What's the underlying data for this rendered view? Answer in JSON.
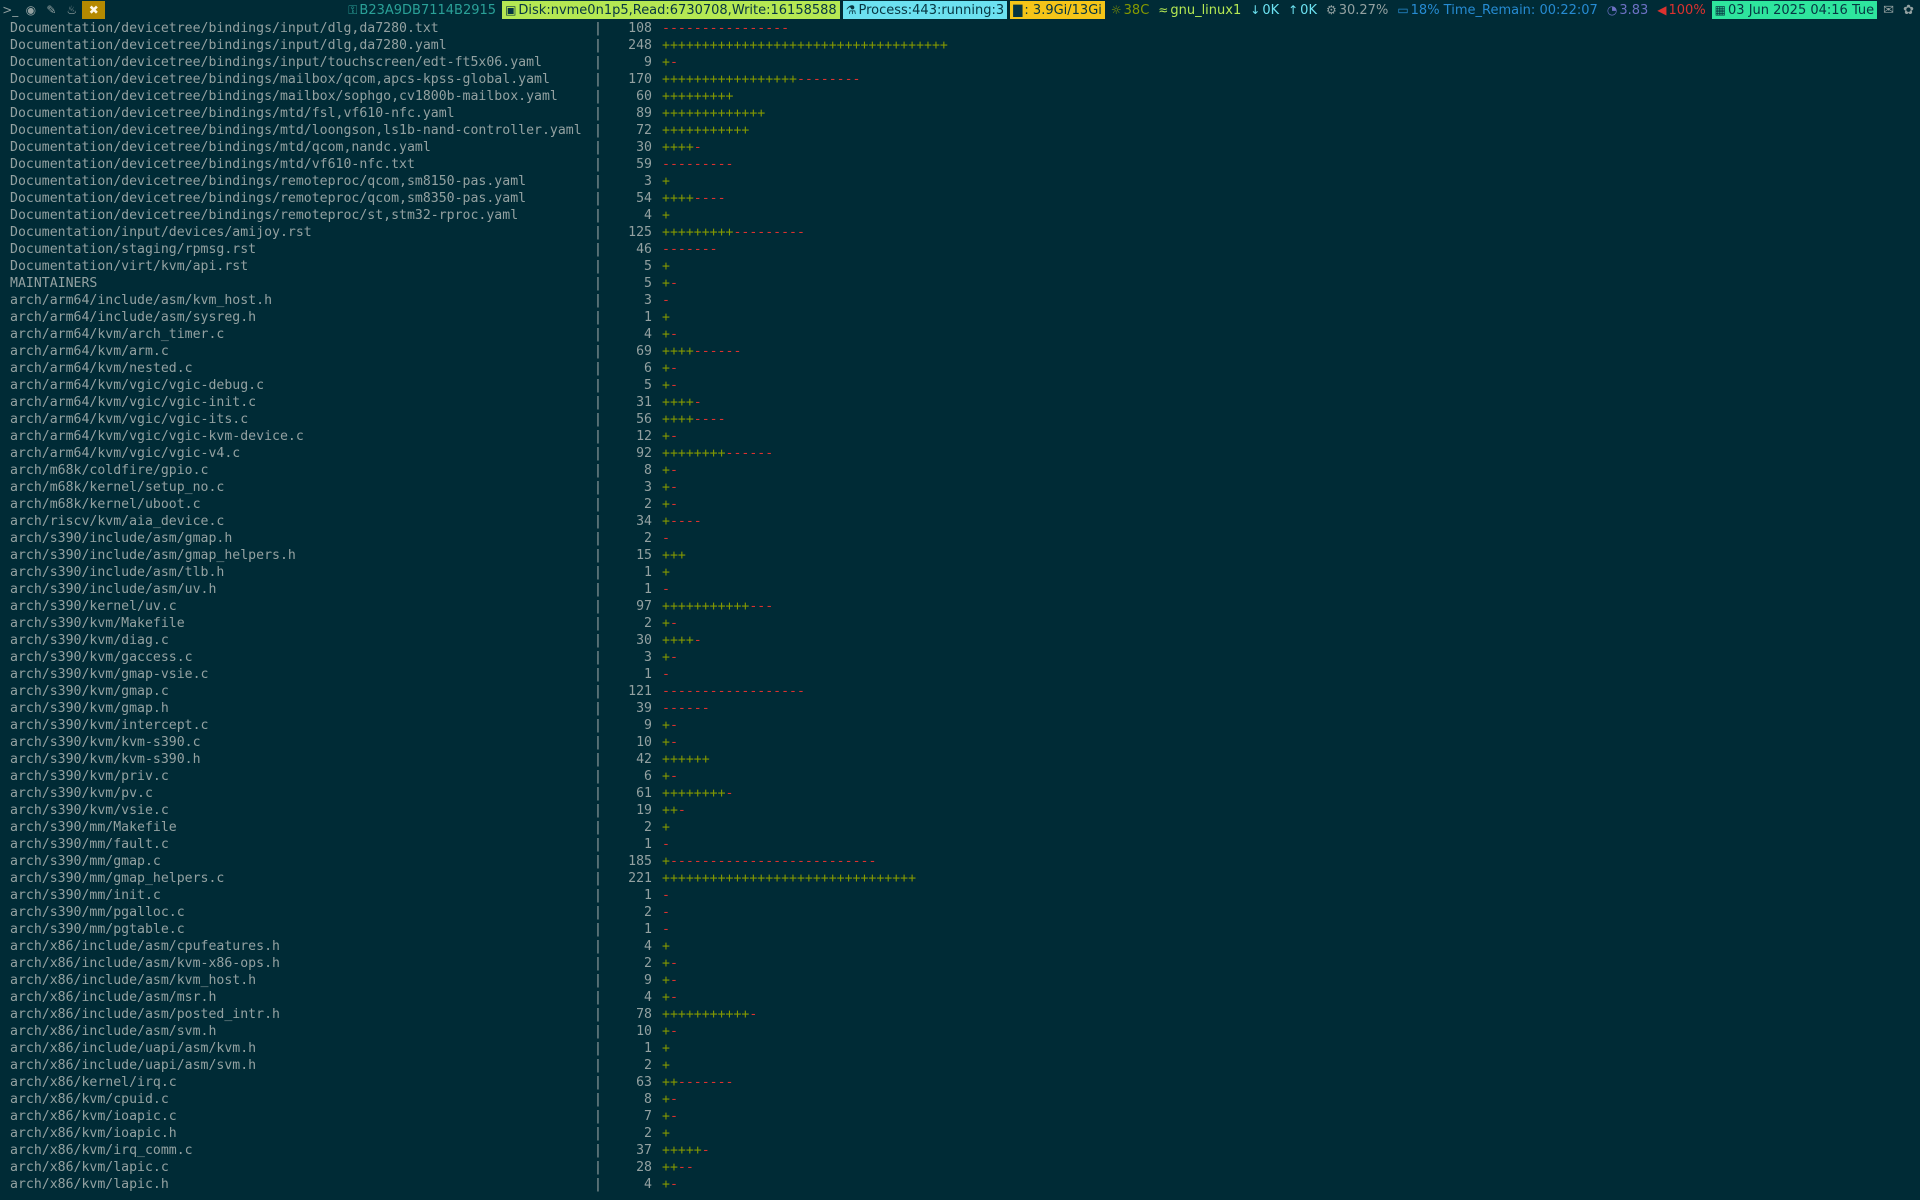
{
  "statusbar": {
    "workspaces": [
      {
        "label": ">_",
        "icon": "terminal-icon"
      },
      {
        "label": "◉",
        "icon": "firefox-icon"
      },
      {
        "label": "✎",
        "icon": "pen-icon"
      },
      {
        "label": "♨",
        "icon": "flame-icon"
      },
      {
        "label": "✖",
        "icon": "tools-icon",
        "active": true
      }
    ],
    "segments": [
      {
        "name": "host-segment",
        "icon": "key-icon",
        "text": "B23A9DB7114B2915",
        "bg": "#002b36",
        "fg": "#2aa198"
      },
      {
        "name": "disk-segment",
        "icon": "disk-icon",
        "text": "Disk:nvme0n1p5,Read:6730708,Write:16158588",
        "bg": "#b5e853",
        "fg": "#073642"
      },
      {
        "name": "process-segment",
        "icon": "flask-icon",
        "text": "Process:443:running:3",
        "bg": "#6ce1f0",
        "fg": "#073642"
      },
      {
        "name": "memory-segment",
        "icon": "chart-icon",
        "text": ": 3.9Gi/13Gi",
        "bg": "#f5c518",
        "fg": "#073642"
      },
      {
        "name": "temp-segment",
        "icon": "thermometer-icon",
        "text": "38C",
        "bg": "#002b36",
        "fg": "#859900"
      },
      {
        "name": "wifi-segment",
        "icon": "wifi-icon",
        "text": "gnu_linux1",
        "bg": "#002b36",
        "fg": "#b5e853"
      },
      {
        "name": "down-segment",
        "icon": "arrow-down-icon",
        "text": "0K",
        "bg": "#002b36",
        "fg": "#6ce1f0"
      },
      {
        "name": "up-segment",
        "icon": "arrow-up-icon",
        "text": "0K",
        "bg": "#002b36",
        "fg": "#6ce1f0"
      },
      {
        "name": "cpu-segment",
        "icon": "gear-icon",
        "text": "30.27%",
        "bg": "#002b36",
        "fg": "#93a1a1"
      },
      {
        "name": "battery-segment",
        "icon": "battery-icon",
        "text": "18% Time_Remain: 00:22:07",
        "bg": "#002b36",
        "fg": "#268bd2"
      },
      {
        "name": "load-segment",
        "icon": "gauge-icon",
        "text": "3.83",
        "bg": "#002b36",
        "fg": "#6c71c4"
      },
      {
        "name": "volume-segment",
        "icon": "speaker-icon",
        "text": "100%",
        "bg": "#002b36",
        "fg": "#dc322f"
      },
      {
        "name": "date-segment",
        "icon": "calendar-icon",
        "text": "03 Jun 2025 04:16 Tue",
        "bg": "#2ee59d",
        "fg": "#073642"
      }
    ],
    "tray": [
      {
        "icon": "mail-icon",
        "glyph": "✉"
      },
      {
        "icon": "chat-icon",
        "glyph": "✿"
      }
    ]
  },
  "diffstat": [
    {
      "path": "Documentation/devicetree/bindings/input/dlg,da7280.txt",
      "count": "108",
      "plus": 0,
      "minus": 16
    },
    {
      "path": "Documentation/devicetree/bindings/input/dlg,da7280.yaml",
      "count": "248",
      "plus": 36,
      "minus": 0
    },
    {
      "path": "Documentation/devicetree/bindings/input/touchscreen/edt-ft5x06.yaml",
      "count": "9",
      "plus": 1,
      "minus": 1
    },
    {
      "path": "Documentation/devicetree/bindings/mailbox/qcom,apcs-kpss-global.yaml",
      "count": "170",
      "plus": 17,
      "minus": 8
    },
    {
      "path": "Documentation/devicetree/bindings/mailbox/sophgo,cv1800b-mailbox.yaml",
      "count": "60",
      "plus": 9,
      "minus": 0
    },
    {
      "path": "Documentation/devicetree/bindings/mtd/fsl,vf610-nfc.yaml",
      "count": "89",
      "plus": 13,
      "minus": 0
    },
    {
      "path": "Documentation/devicetree/bindings/mtd/loongson,ls1b-nand-controller.yaml",
      "count": "72",
      "plus": 11,
      "minus": 0
    },
    {
      "path": "Documentation/devicetree/bindings/mtd/qcom,nandc.yaml",
      "count": "30",
      "plus": 4,
      "minus": 1
    },
    {
      "path": "Documentation/devicetree/bindings/mtd/vf610-nfc.txt",
      "count": "59",
      "plus": 0,
      "minus": 9
    },
    {
      "path": "Documentation/devicetree/bindings/remoteproc/qcom,sm8150-pas.yaml",
      "count": "3",
      "plus": 1,
      "minus": 0
    },
    {
      "path": "Documentation/devicetree/bindings/remoteproc/qcom,sm8350-pas.yaml",
      "count": "54",
      "plus": 4,
      "minus": 4
    },
    {
      "path": "Documentation/devicetree/bindings/remoteproc/st,stm32-rproc.yaml",
      "count": "4",
      "plus": 1,
      "minus": 0
    },
    {
      "path": "Documentation/input/devices/amijoy.rst",
      "count": "125",
      "plus": 9,
      "minus": 9
    },
    {
      "path": "Documentation/staging/rpmsg.rst",
      "count": "46",
      "plus": 0,
      "minus": 7
    },
    {
      "path": "Documentation/virt/kvm/api.rst",
      "count": "5",
      "plus": 1,
      "minus": 0
    },
    {
      "path": "MAINTAINERS",
      "count": "5",
      "plus": 1,
      "minus": 1
    },
    {
      "path": "arch/arm64/include/asm/kvm_host.h",
      "count": "3",
      "plus": 0,
      "minus": 1
    },
    {
      "path": "arch/arm64/include/asm/sysreg.h",
      "count": "1",
      "plus": 1,
      "minus": 0
    },
    {
      "path": "arch/arm64/kvm/arch_timer.c",
      "count": "4",
      "plus": 1,
      "minus": 1
    },
    {
      "path": "arch/arm64/kvm/arm.c",
      "count": "69",
      "plus": 4,
      "minus": 6
    },
    {
      "path": "arch/arm64/kvm/nested.c",
      "count": "6",
      "plus": 1,
      "minus": 1
    },
    {
      "path": "arch/arm64/kvm/vgic/vgic-debug.c",
      "count": "5",
      "plus": 1,
      "minus": 1
    },
    {
      "path": "arch/arm64/kvm/vgic/vgic-init.c",
      "count": "31",
      "plus": 4,
      "minus": 1
    },
    {
      "path": "arch/arm64/kvm/vgic/vgic-its.c",
      "count": "56",
      "plus": 4,
      "minus": 4
    },
    {
      "path": "arch/arm64/kvm/vgic/vgic-kvm-device.c",
      "count": "12",
      "plus": 1,
      "minus": 1
    },
    {
      "path": "arch/arm64/kvm/vgic/vgic-v4.c",
      "count": "92",
      "plus": 8,
      "minus": 6
    },
    {
      "path": "arch/m68k/coldfire/gpio.c",
      "count": "8",
      "plus": 1,
      "minus": 1
    },
    {
      "path": "arch/m68k/kernel/setup_no.c",
      "count": "3",
      "plus": 1,
      "minus": 1
    },
    {
      "path": "arch/m68k/kernel/uboot.c",
      "count": "2",
      "plus": 1,
      "minus": 1
    },
    {
      "path": "arch/riscv/kvm/aia_device.c",
      "count": "34",
      "plus": 1,
      "minus": 4
    },
    {
      "path": "arch/s390/include/asm/gmap.h",
      "count": "2",
      "plus": 0,
      "minus": 1
    },
    {
      "path": "arch/s390/include/asm/gmap_helpers.h",
      "count": "15",
      "plus": 3,
      "minus": 0
    },
    {
      "path": "arch/s390/include/asm/tlb.h",
      "count": "1",
      "plus": 1,
      "minus": 0
    },
    {
      "path": "arch/s390/include/asm/uv.h",
      "count": "1",
      "plus": 0,
      "minus": 1
    },
    {
      "path": "arch/s390/kernel/uv.c",
      "count": "97",
      "plus": 11,
      "minus": 3
    },
    {
      "path": "arch/s390/kvm/Makefile",
      "count": "2",
      "plus": 1,
      "minus": 1
    },
    {
      "path": "arch/s390/kvm/diag.c",
      "count": "30",
      "plus": 4,
      "minus": 1
    },
    {
      "path": "arch/s390/kvm/gaccess.c",
      "count": "3",
      "plus": 1,
      "minus": 1
    },
    {
      "path": "arch/s390/kvm/gmap-vsie.c",
      "count": "1",
      "plus": 0,
      "minus": 1
    },
    {
      "path": "arch/s390/kvm/gmap.c",
      "count": "121",
      "plus": 0,
      "minus": 18
    },
    {
      "path": "arch/s390/kvm/gmap.h",
      "count": "39",
      "plus": 0,
      "minus": 6
    },
    {
      "path": "arch/s390/kvm/intercept.c",
      "count": "9",
      "plus": 1,
      "minus": 1
    },
    {
      "path": "arch/s390/kvm/kvm-s390.c",
      "count": "10",
      "plus": 1,
      "minus": 1
    },
    {
      "path": "arch/s390/kvm/kvm-s390.h",
      "count": "42",
      "plus": 6,
      "minus": 0
    },
    {
      "path": "arch/s390/kvm/priv.c",
      "count": "6",
      "plus": 1,
      "minus": 1
    },
    {
      "path": "arch/s390/kvm/pv.c",
      "count": "61",
      "plus": 8,
      "minus": 1
    },
    {
      "path": "arch/s390/kvm/vsie.c",
      "count": "19",
      "plus": 2,
      "minus": 1
    },
    {
      "path": "arch/s390/mm/Makefile",
      "count": "2",
      "plus": 1,
      "minus": 0
    },
    {
      "path": "arch/s390/mm/fault.c",
      "count": "1",
      "plus": 0,
      "minus": 1
    },
    {
      "path": "arch/s390/mm/gmap.c",
      "count": "185",
      "plus": 1,
      "minus": 26
    },
    {
      "path": "arch/s390/mm/gmap_helpers.c",
      "count": "221",
      "plus": 32,
      "minus": 0
    },
    {
      "path": "arch/s390/mm/init.c",
      "count": "1",
      "plus": 0,
      "minus": 1
    },
    {
      "path": "arch/s390/mm/pgalloc.c",
      "count": "2",
      "plus": 0,
      "minus": 1
    },
    {
      "path": "arch/s390/mm/pgtable.c",
      "count": "1",
      "plus": 0,
      "minus": 1
    },
    {
      "path": "arch/x86/include/asm/cpufeatures.h",
      "count": "4",
      "plus": 1,
      "minus": 0
    },
    {
      "path": "arch/x86/include/asm/kvm-x86-ops.h",
      "count": "2",
      "plus": 1,
      "minus": 1
    },
    {
      "path": "arch/x86/include/asm/kvm_host.h",
      "count": "9",
      "plus": 1,
      "minus": 1
    },
    {
      "path": "arch/x86/include/asm/msr.h",
      "count": "4",
      "plus": 1,
      "minus": 1
    },
    {
      "path": "arch/x86/include/asm/posted_intr.h",
      "count": "78",
      "plus": 11,
      "minus": 1
    },
    {
      "path": "arch/x86/include/asm/svm.h",
      "count": "10",
      "plus": 1,
      "minus": 1
    },
    {
      "path": "arch/x86/include/uapi/asm/kvm.h",
      "count": "1",
      "plus": 1,
      "minus": 0
    },
    {
      "path": "arch/x86/include/uapi/asm/svm.h",
      "count": "2",
      "plus": 1,
      "minus": 0
    },
    {
      "path": "arch/x86/kernel/irq.c",
      "count": "63",
      "plus": 2,
      "minus": 7
    },
    {
      "path": "arch/x86/kvm/cpuid.c",
      "count": "8",
      "plus": 1,
      "minus": 1
    },
    {
      "path": "arch/x86/kvm/ioapic.c",
      "count": "7",
      "plus": 1,
      "minus": 1
    },
    {
      "path": "arch/x86/kvm/ioapic.h",
      "count": "2",
      "plus": 1,
      "minus": 0
    },
    {
      "path": "arch/x86/kvm/irq_comm.c",
      "count": "37",
      "plus": 5,
      "minus": 1
    },
    {
      "path": "arch/x86/kvm/lapic.c",
      "count": "28",
      "plus": 2,
      "minus": 2
    },
    {
      "path": "arch/x86/kvm/lapic.h",
      "count": "4",
      "plus": 1,
      "minus": 1
    }
  ]
}
